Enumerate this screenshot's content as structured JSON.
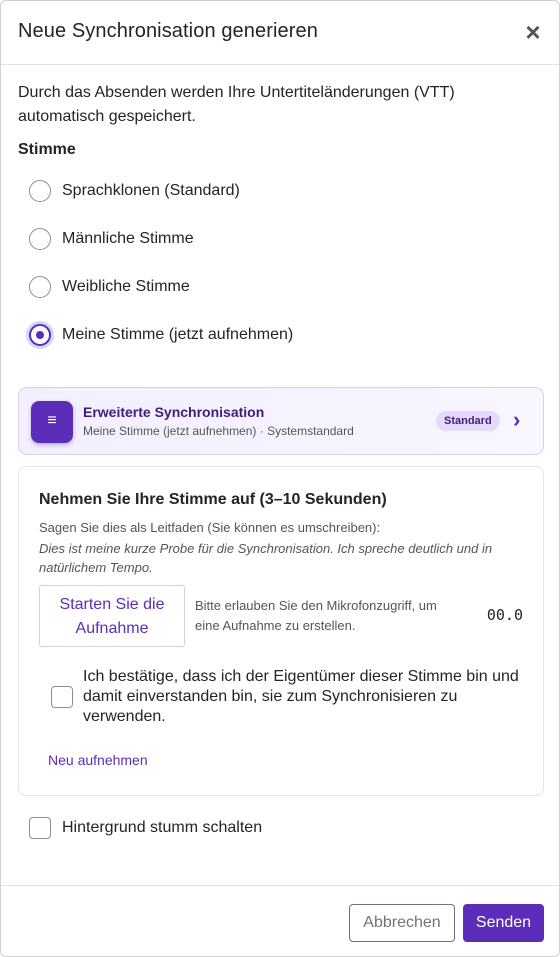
{
  "header": {
    "title": "Neue Synchronisation generieren",
    "close_symbol": "×"
  },
  "notice": "Durch das Absenden werden Ihre Untertiteländerungen (VTT) automatisch gespeichert.",
  "voice": {
    "label": "Stimme",
    "options": [
      {
        "label": "Sprachklonen (Standard)",
        "checked": false
      },
      {
        "label": "Männliche Stimme",
        "checked": false
      },
      {
        "label": "Weibliche Stimme",
        "checked": false
      },
      {
        "label": "Meine Stimme (jetzt aufnehmen)",
        "checked": true
      }
    ]
  },
  "advanced": {
    "icon": "list-icon",
    "icon_glyph": "≡",
    "title": "Erweiterte Synchronisation",
    "subtitle": "Meine Stimme (jetzt aufnehmen) · Systemstandard",
    "badge": "Standard",
    "chevron": "›"
  },
  "recording": {
    "title": "Nehmen Sie Ihre Stimme auf (3–10 Sekunden)",
    "hint": "Sagen Sie dies als Leitfaden (Sie können es umschreiben):",
    "script": "Dies ist meine kurze Probe für die Synchronisation. Ich spreche deutlich und in natürlichem Tempo.",
    "start_button": "Starten Sie die Aufnahme",
    "mic_note": "Bitte erlauben Sie den Mikrofonzugriff, um eine Aufnahme zu erstellen.",
    "timer": "00.0",
    "consent": "Ich bestätige, dass ich der Eigentümer dieser Stimme bin und damit einverstanden bin, sie zum Synchronisieren zu verwenden.",
    "consent_checked": false,
    "rerecord": "Neu aufnehmen"
  },
  "mute": {
    "label": "Hintergrund stumm schalten",
    "checked": false
  },
  "footer": {
    "cancel": "Abbrechen",
    "submit": "Senden"
  },
  "colors": {
    "accent": "#5b2db8",
    "badge_bg": "#e4dafb",
    "card_bg": "#f3efff"
  }
}
